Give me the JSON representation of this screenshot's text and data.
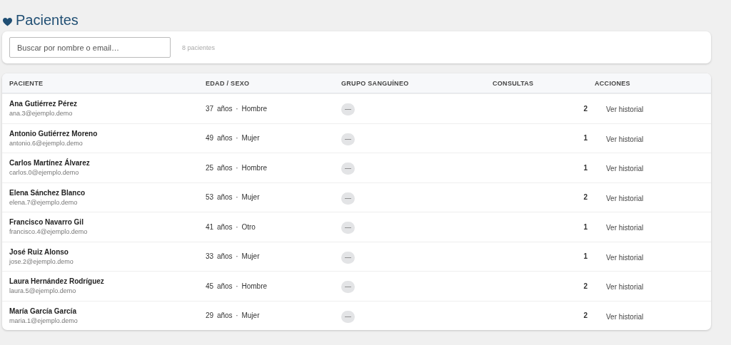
{
  "page": {
    "title": "Pacientes"
  },
  "search": {
    "placeholder": "Buscar por nombre o email…",
    "count": "8 pacientes"
  },
  "table": {
    "columns": [
      "PACIENTE",
      "EDAD / SEXO",
      "GRUPO SANGUÍNEO",
      "CONSULTAS",
      "ACCIONES"
    ],
    "rows": [
      {
        "name": "Ana Gutiérrez Pérez",
        "email": "ana.3@ejemplo.demo",
        "age_sex": "37 años · Hombre",
        "blood_group": "—",
        "consultations": "2",
        "action": "Ver historial"
      },
      {
        "name": "Antonio Gutiérrez Moreno",
        "email": "antonio.6@ejemplo.demo",
        "age_sex": "49 años · Mujer",
        "blood_group": "—",
        "consultations": "1",
        "action": "Ver historial"
      },
      {
        "name": "Carlos Martínez Álvarez",
        "email": "carlos.0@ejemplo.demo",
        "age_sex": "25 años · Hombre",
        "blood_group": "—",
        "consultations": "1",
        "action": "Ver historial"
      },
      {
        "name": "Elena Sánchez Blanco",
        "email": "elena.7@ejemplo.demo",
        "age_sex": "53 años · Mujer",
        "blood_group": "—",
        "consultations": "2",
        "action": "Ver historial"
      },
      {
        "name": "Francisco Navarro Gil",
        "email": "francisco.4@ejemplo.demo",
        "age_sex": "41 años · Otro",
        "blood_group": "—",
        "consultations": "1",
        "action": "Ver historial"
      },
      {
        "name": "José Ruiz Alonso",
        "email": "jose.2@ejemplo.demo",
        "age_sex": "33 años · Mujer",
        "blood_group": "—",
        "consultations": "1",
        "action": "Ver historial"
      },
      {
        "name": "Laura Hernández Rodríguez",
        "email": "laura.5@ejemplo.demo",
        "age_sex": "45 años · Hombre",
        "blood_group": "—",
        "consultations": "2",
        "action": "Ver historial"
      },
      {
        "name": "María García García",
        "email": "maria.1@ejemplo.demo",
        "age_sex": "29 años · Mujer",
        "blood_group": "—",
        "consultations": "2",
        "action": "Ver historial"
      }
    ]
  }
}
